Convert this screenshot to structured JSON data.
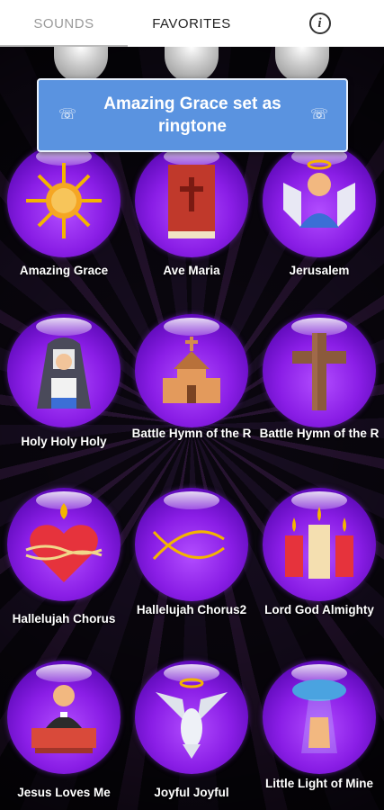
{
  "tabs": [
    {
      "label": "SOUNDS",
      "active": true
    },
    {
      "label": "FAVORITES",
      "active": false
    }
  ],
  "info": {
    "glyph": "i"
  },
  "toast": {
    "message": "Amazing Grace set as ringtone"
  },
  "top_row_icons": [
    "question-icon",
    "minus-icon",
    "share-icon"
  ],
  "sounds": [
    {
      "label": "Amazing Grace",
      "icon": "sun-cross-icon"
    },
    {
      "label": "Ave Maria",
      "icon": "bible-icon"
    },
    {
      "label": "Jerusalem",
      "icon": "angel-icon"
    },
    {
      "label": "Holy Holy Holy",
      "icon": "nun-icon"
    },
    {
      "label": "Battle Hymn of the R",
      "icon": "church-icon"
    },
    {
      "label": "Battle Hymn of the R",
      "icon": "cross-icon"
    },
    {
      "label": "Hallelujah Chorus",
      "icon": "sacred-heart-icon"
    },
    {
      "label": "Hallelujah Chorus2",
      "icon": "ichthys-fish-icon"
    },
    {
      "label": "Lord God Almighty",
      "icon": "candles-icon"
    },
    {
      "label": "Jesus Loves Me",
      "icon": "priest-icon"
    },
    {
      "label": "Joyful Joyful",
      "icon": "dove-icon"
    },
    {
      "label": "Little Light of Mine",
      "icon": "hand-light-icon"
    }
  ]
}
